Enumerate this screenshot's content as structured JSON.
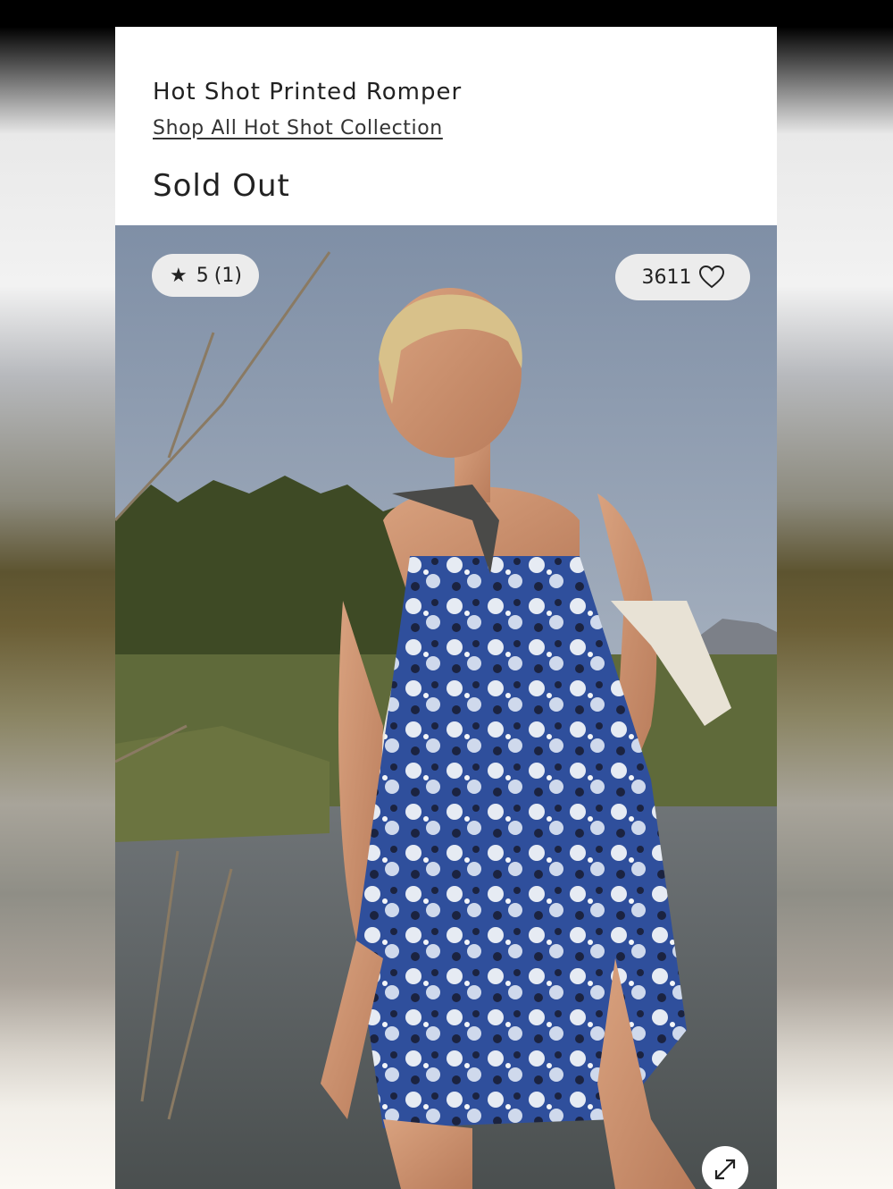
{
  "product": {
    "title": "Hot Shot Printed Romper",
    "collection_link": "Shop All Hot Shot Collection",
    "status": "Sold Out"
  },
  "image": {
    "rating_value": "5",
    "rating_count": "(1)",
    "likes": "3611",
    "icons": {
      "rating": "star-icon",
      "likes": "heart-icon",
      "zoom": "expand-icon"
    }
  },
  "colors": {
    "card_background": "#ffffff",
    "pill_background": "#ececec",
    "text": "#222222"
  }
}
